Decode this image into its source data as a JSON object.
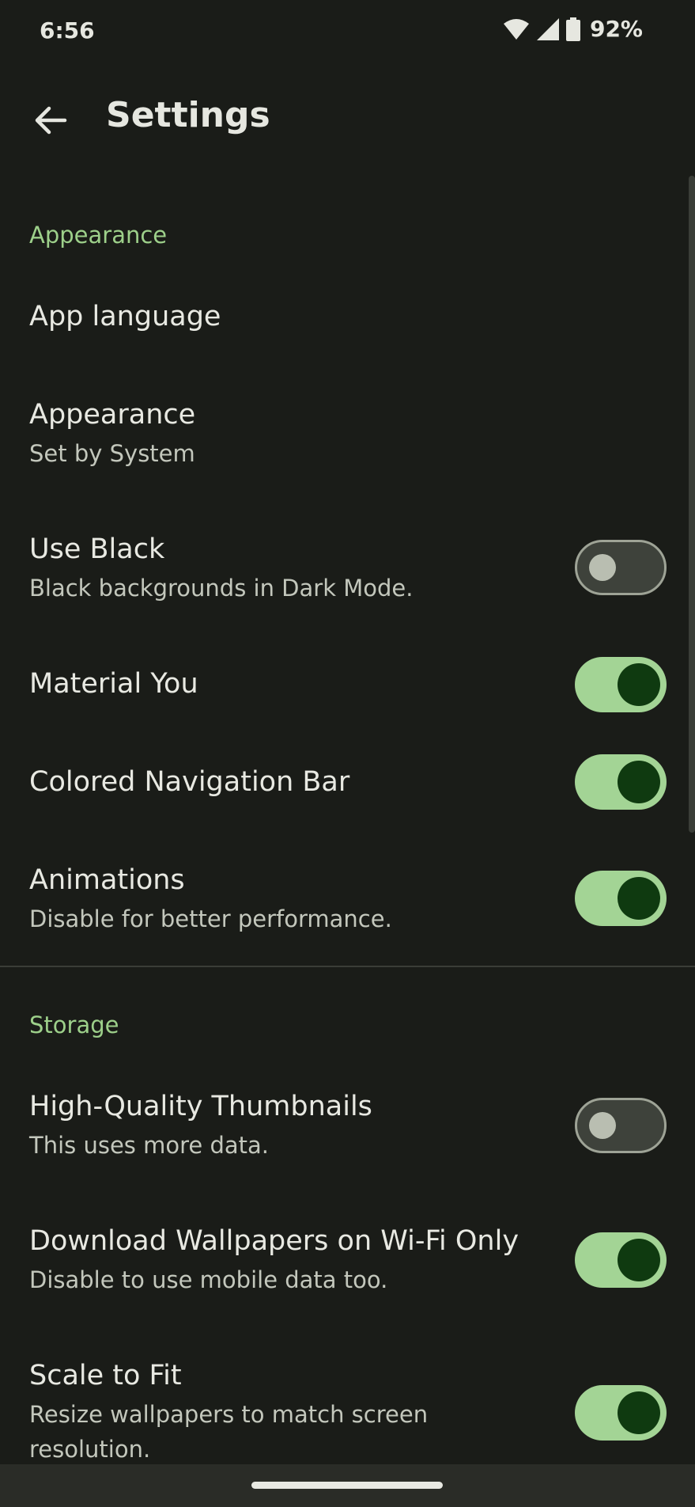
{
  "status_bar": {
    "time": "6:56",
    "battery_percent": "92%",
    "icons": [
      "wifi-icon",
      "signal-icon",
      "battery-icon"
    ]
  },
  "header": {
    "title": "Settings",
    "back_icon": "arrow-back-icon"
  },
  "colors": {
    "background": "#1a1c18",
    "accent": "#9dd08a",
    "switch_on_track": "#a3d495",
    "switch_on_thumb": "#0f3a10",
    "switch_off_track": "#3e423b"
  },
  "sections": {
    "appearance": {
      "title": "Appearance",
      "items": [
        {
          "title": "App language"
        },
        {
          "title": "Appearance",
          "subtitle": "Set by System"
        },
        {
          "title": "Use Black",
          "subtitle": "Black backgrounds in Dark Mode.",
          "toggle": false
        },
        {
          "title": "Material You",
          "toggle": true
        },
        {
          "title": "Colored Navigation Bar",
          "toggle": true
        },
        {
          "title": "Animations",
          "subtitle": "Disable for better performance.",
          "toggle": true
        }
      ]
    },
    "storage": {
      "title": "Storage",
      "items": [
        {
          "title": "High-Quality Thumbnails",
          "subtitle": "This uses more data.",
          "toggle": false
        },
        {
          "title": "Download Wallpapers on Wi-Fi Only",
          "subtitle": "Disable to use mobile data too.",
          "toggle": true
        },
        {
          "title": "Scale to Fit",
          "subtitle": "Resize wallpapers to match screen resolution.",
          "toggle": true
        }
      ]
    }
  }
}
